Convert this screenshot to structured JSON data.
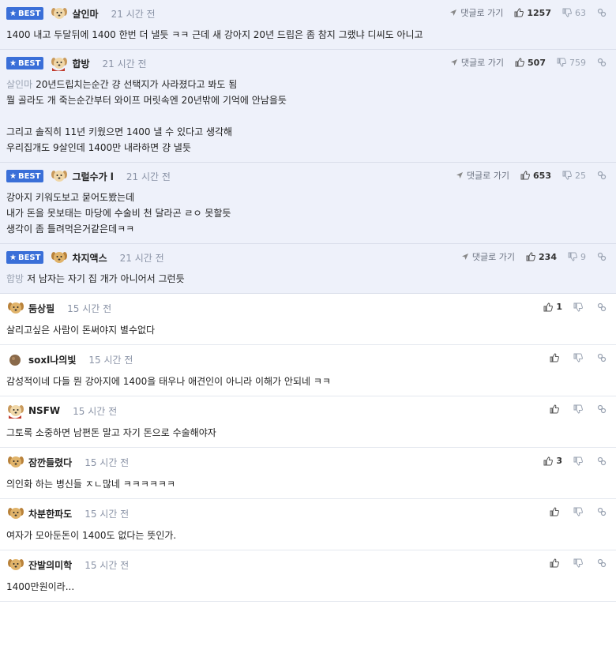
{
  "best_label": "BEST",
  "reply_label": "댓글로 가기",
  "comments": [
    {
      "best": true,
      "avatar": "puppy-avatar",
      "nick": "살인마",
      "time": "21 시간 전",
      "up": "1257",
      "down": "63",
      "mention": "",
      "lines": [
        "1400 내고 두달뒤에 1400 한번 더 낼듯 ㅋㅋ 근데 새 강아지 20년 드립은 좀 참지 그랬냐 디씨도 아니고"
      ]
    },
    {
      "best": true,
      "avatar": "puppy-cape-avatar",
      "nick": "합방",
      "time": "21 시간 전",
      "up": "507",
      "down": "759",
      "mention": "살인마",
      "lines": [
        "20년드립치는순간 걍 선택지가 사라졌다고 봐도 됨",
        "뭘 골라도 개 죽는순간부터 와이프 머릿속엔 20년밖에 기억에 안남을듯",
        "",
        "그리고 솔직히 11년 키웠으면 1400 낼 수 있다고 생각해",
        "우리집개도 9살인데 1400만 내라하면 걍 낼듯"
      ]
    },
    {
      "best": true,
      "avatar": "puppy-avatar",
      "nick": "그럴수가 l",
      "time": "21 시간 전",
      "up": "653",
      "down": "25",
      "mention": "",
      "lines": [
        "강아지 키워도보고 묻어도봤는데",
        "내가 돈을 못보태는 마당에 수술비 천 달라곤 ㄹㅇ 못할듯",
        "생각이 좀 틀려먹은거같은데ㅋㅋ"
      ]
    },
    {
      "best": true,
      "avatar": "puppy-gold-avatar",
      "nick": "차지액스",
      "time": "21 시간 전",
      "up": "234",
      "down": "9",
      "mention": "합방",
      "lines": [
        "저 남자는 자기 집 개가 아니어서 그런듯"
      ]
    },
    {
      "best": false,
      "avatar": "puppy-gold-avatar",
      "nick": "둠상필",
      "time": "15 시간 전",
      "up": "1",
      "down": "",
      "mention": "",
      "lines": [
        "살리고싶은 사람이 돈써야지 별수없다"
      ]
    },
    {
      "best": false,
      "avatar": "ball-avatar",
      "nick": "soxl나의빛",
      "time": "15 시간 전",
      "up": "",
      "down": "",
      "mention": "",
      "lines": [
        "감성적이네 다들 뭔 강아지에 1400을 태우나 애견인이 아니라 이해가 안되네 ㅋㅋ"
      ]
    },
    {
      "best": false,
      "avatar": "puppy-cape-avatar",
      "nick": "NSFW",
      "time": "15 시간 전",
      "up": "",
      "down": "",
      "mention": "",
      "lines": [
        "그토록 소중하면 남편돈 말고 자기 돈으로 수술해야자"
      ]
    },
    {
      "best": false,
      "avatar": "puppy-gold-avatar",
      "nick": "잠깐들렸다",
      "time": "15 시간 전",
      "up": "3",
      "down": "",
      "mention": "",
      "lines": [
        "의인화 하는 병신들 ㅈㄴ많네 ㅋㅋㅋㅋㅋㅋ"
      ]
    },
    {
      "best": false,
      "avatar": "puppy-gold-avatar",
      "nick": "차분한파도",
      "time": "15 시간 전",
      "up": "",
      "down": "",
      "mention": "",
      "lines": [
        "여자가 모아둔돈이 1400도 없다는 뜻인가."
      ]
    },
    {
      "best": false,
      "avatar": "puppy-gold-avatar",
      "nick": "잔발의미학",
      "time": "15 시간 전",
      "up": "",
      "down": "",
      "mention": "",
      "lines": [
        "1400만원이라..."
      ]
    }
  ],
  "colors": {
    "badge": "#3a6fd8",
    "best_bg": "#eef1fa",
    "muted": "#8a93a6"
  }
}
